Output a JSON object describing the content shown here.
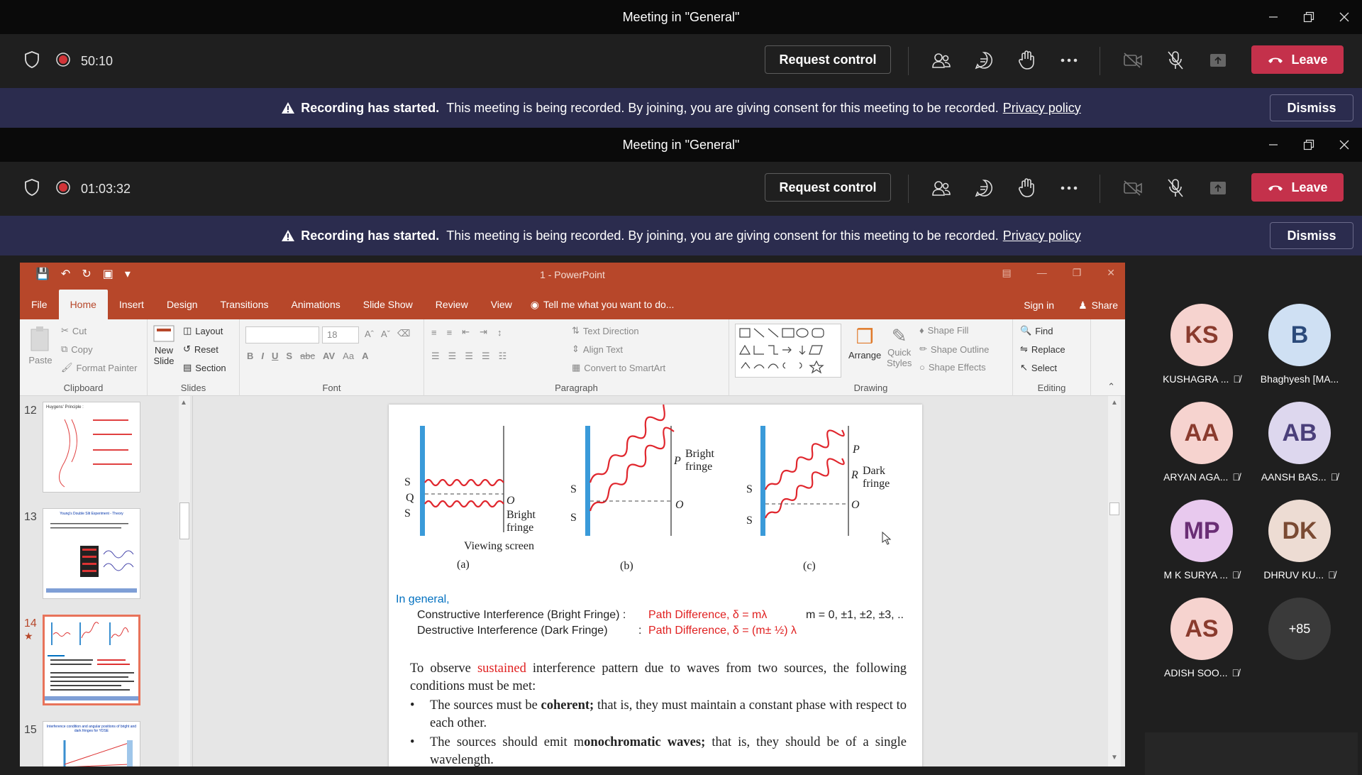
{
  "windows": [
    {
      "title": "Meeting in \"General\"",
      "timer": "50:10"
    },
    {
      "title": "Meeting in \"General\"",
      "timer": "01:03:32"
    }
  ],
  "callbar": {
    "request_control": "Request control",
    "leave": "Leave"
  },
  "banner": {
    "bold": "Recording has started.",
    "text": "This meeting is being recorded. By joining, you are giving consent for this meeting to be recorded.",
    "link": "Privacy policy",
    "dismiss": "Dismiss"
  },
  "ppt": {
    "title": "1 - PowerPoint",
    "tabs": [
      "File",
      "Home",
      "Insert",
      "Design",
      "Transitions",
      "Animations",
      "Slide Show",
      "Review",
      "View"
    ],
    "tell_me": "Tell me what you want to do...",
    "sign_in": "Sign in",
    "share": "Share",
    "ribbon": {
      "clipboard": {
        "label": "Clipboard",
        "paste": "Paste",
        "cut": "Cut",
        "copy": "Copy",
        "format_painter": "Format Painter"
      },
      "slides": {
        "label": "Slides",
        "new_slide": "New",
        "new_slide2": "Slide",
        "layout": "Layout",
        "reset": "Reset",
        "section": "Section"
      },
      "font": {
        "label": "Font",
        "size": "18"
      },
      "paragraph": {
        "label": "Paragraph",
        "text_direction": "Text Direction",
        "align_text": "Align Text",
        "convert": "Convert to SmartArt"
      },
      "drawing": {
        "label": "Drawing",
        "arrange": "Arrange",
        "quick_styles": "Quick",
        "quick_styles2": "Styles",
        "shape_fill": "Shape Fill",
        "shape_outline": "Shape Outline",
        "shape_effects": "Shape Effects"
      },
      "editing": {
        "label": "Editing",
        "find": "Find",
        "replace": "Replace",
        "select": "Select"
      }
    },
    "thumbnails": [
      {
        "num": "12",
        "title": "Huygens' Principle :"
      },
      {
        "num": "13",
        "title": "Young's Double Slit Experiment - Theory"
      },
      {
        "num": "14",
        "title": ""
      },
      {
        "num": "15",
        "title": "Interference condition and angular positions of bright and dark fringes for YDSE"
      }
    ],
    "slide": {
      "fig_labels": {
        "s1": "S",
        "q": "Q",
        "s2": "S",
        "o": "O",
        "bright_fringe_a": "Bright",
        "bright_fringe_a2": "fringe",
        "viewing_screen": "Viewing screen",
        "a": "(a)",
        "b": "(b)",
        "c": "(c)",
        "p": "P",
        "bright_fringe_b": "Bright",
        "bright_fringe_b2": "fringe",
        "r": "R",
        "dark_fringe": "Dark",
        "dark_fringe2": "fringe"
      },
      "in_general": "In general,",
      "constructive_label": "Constructive Interference (Bright Fringe) :",
      "constructive_value": "Path Difference, δ = mλ",
      "m_values": "m = 0, ±1, ±2, ±3, ..",
      "destructive_label": "Destructive Interference (Dark Fringe)",
      "destructive_colon": ":",
      "destructive_value": "Path Difference, δ = (m± ½) λ",
      "para_start": "To observe",
      "para_sustained": "sustained",
      "para_rest": "interference pattern due to waves from two sources, the following conditions must be met:",
      "bullet1_start": "The sources must be",
      "bullet1_bold": "coherent;",
      "bullet1_rest": "that is, they must maintain a constant phase with respect to each other.",
      "bullet2_start": "The sources should emit m",
      "bullet2_bold": "onochromatic waves;",
      "bullet2_rest": "that is, they should be of a single wavelength."
    }
  },
  "participants": [
    {
      "initials": "KS",
      "name": "KUSHAGRA ...",
      "color": "#f6d3cf",
      "muted": true
    },
    {
      "initials": "B",
      "name": "Bhaghyesh [MA...",
      "color": "#cfe0f3",
      "muted": false
    },
    {
      "initials": "AA",
      "name": "ARYAN AGA...",
      "color": "#f6d3cf",
      "muted": true
    },
    {
      "initials": "AB",
      "name": "AANSH BAS...",
      "color": "#ddd7ee",
      "muted": true
    },
    {
      "initials": "MP",
      "name": "M K SURYA ...",
      "color": "#e8c9ee",
      "muted": true
    },
    {
      "initials": "DK",
      "name": "DHRUV KU...",
      "color": "#eddcd3",
      "muted": true
    },
    {
      "initials": "AS",
      "name": "ADISH SOO...",
      "color": "#f6d3cf",
      "muted": true
    },
    {
      "initials": "+85",
      "name": "",
      "color": "#3a3a3a",
      "muted": false
    }
  ]
}
